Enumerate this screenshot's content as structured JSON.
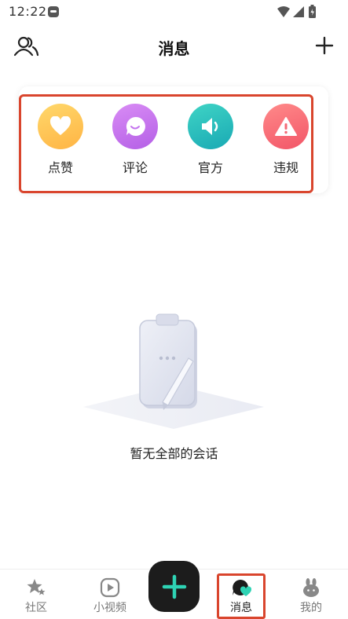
{
  "status_bar": {
    "time": "12:22",
    "icons": [
      "app-notification-icon",
      "wifi-icon",
      "cell-signal-icon",
      "battery-icon"
    ]
  },
  "header": {
    "title": "消息",
    "left_icon": "contacts-icon",
    "right_icon": "plus-icon"
  },
  "categories": [
    {
      "label": "点赞",
      "icon": "heart-icon",
      "color": "#ffc455"
    },
    {
      "label": "评论",
      "icon": "chat-bubble-icon",
      "color": "#c473ee"
    },
    {
      "label": "官方",
      "icon": "speaker-icon",
      "color": "#26bdbd"
    },
    {
      "label": "违规",
      "icon": "warning-icon",
      "color": "#f46a76"
    }
  ],
  "empty_state": {
    "text": "暂无全部的会话",
    "icon": "clipboard-illustration"
  },
  "bottom_nav": {
    "items": [
      {
        "label": "社区",
        "icon": "stars-icon"
      },
      {
        "label": "小视频",
        "icon": "play-icon"
      },
      {
        "label": "消息",
        "icon": "message-heart-icon",
        "active": true
      },
      {
        "label": "我的",
        "icon": "bunny-icon"
      }
    ],
    "compose_icon": "plus-icon",
    "accent": "#2ed3b4"
  },
  "highlight_color": "#d9452d"
}
